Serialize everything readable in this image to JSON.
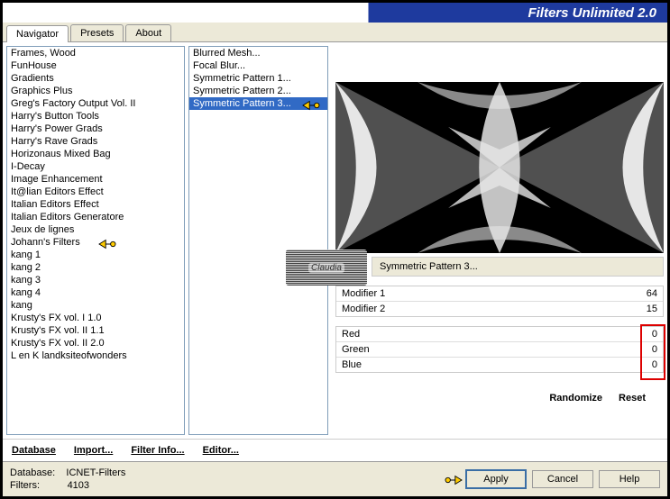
{
  "header": {
    "title": "Filters Unlimited 2.0"
  },
  "tabs": [
    {
      "label": "Navigator",
      "active": true
    },
    {
      "label": "Presets",
      "active": false
    },
    {
      "label": "About",
      "active": false
    }
  ],
  "categories": [
    "Frames, Wood",
    "FunHouse",
    "Gradients",
    "Graphics Plus",
    "Greg's Factory Output Vol. II",
    "Harry's Button Tools",
    "Harry's Power Grads",
    "Harry's Rave Grads",
    "Horizonaus Mixed Bag",
    "I-Decay",
    "Image Enhancement",
    "It@lian Editors Effect",
    "Italian Editors Effect",
    "Italian Editors Generatore",
    "Jeux de lignes",
    "Johann's Filters",
    "kang 1",
    "kang 2",
    "kang 3",
    "kang 4",
    "kang",
    "Krusty's FX vol. I 1.0",
    "Krusty's FX vol. II 1.1",
    "Krusty's FX vol. II 2.0",
    "L en K landksiteofwonders"
  ],
  "selected_category_index": 15,
  "filters": [
    "Blurred Mesh...",
    "Focal Blur...",
    "Symmetric Pattern 1...",
    "Symmetric Pattern 2...",
    "Symmetric Pattern 3..."
  ],
  "selected_filter_index": 4,
  "filter_title": "Symmetric Pattern 3...",
  "watermark": "Claudia",
  "params": {
    "modifiers": [
      {
        "name": "Modifier 1",
        "value": "64"
      },
      {
        "name": "Modifier 2",
        "value": "15"
      }
    ],
    "colors": [
      {
        "name": "Red",
        "value": "0"
      },
      {
        "name": "Green",
        "value": "0"
      },
      {
        "name": "Blue",
        "value": "0"
      }
    ]
  },
  "bottom_links": {
    "database": "Database",
    "import": "Import...",
    "filter_info": "Filter Info...",
    "editor": "Editor...",
    "randomize": "Randomize",
    "reset": "Reset"
  },
  "status": {
    "db_label": "Database:",
    "db_value": "ICNET-Filters",
    "filters_label": "Filters:",
    "filters_value": "4103"
  },
  "buttons": {
    "apply": "Apply",
    "cancel": "Cancel",
    "help": "Help"
  }
}
